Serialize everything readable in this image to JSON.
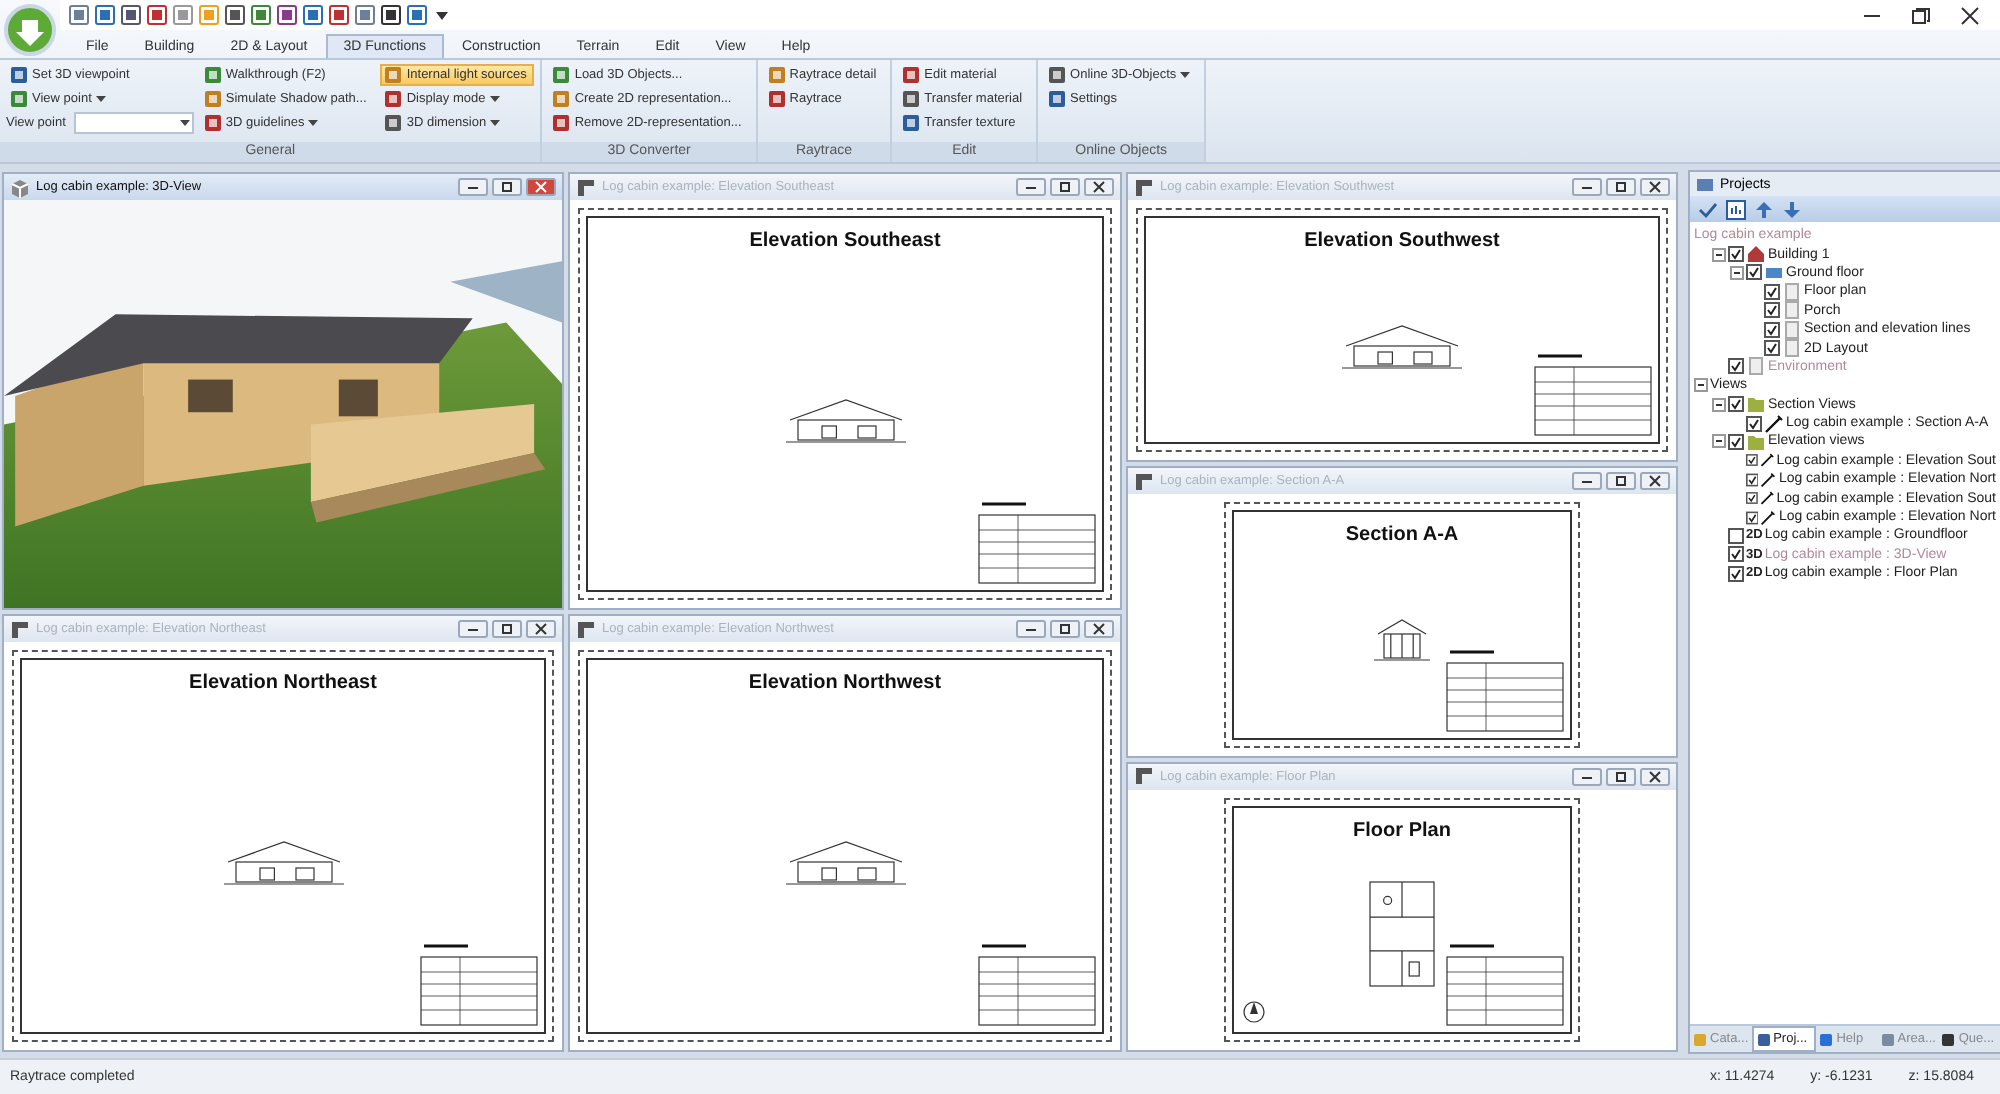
{
  "tabs": [
    {
      "label": "File",
      "selected": false
    },
    {
      "label": "Building",
      "selected": false
    },
    {
      "label": "2D & Layout",
      "selected": false
    },
    {
      "label": "3D Functions",
      "selected": true
    },
    {
      "label": "Construction",
      "selected": false
    },
    {
      "label": "Terrain",
      "selected": false
    },
    {
      "label": "Edit",
      "selected": false
    },
    {
      "label": "View",
      "selected": false
    },
    {
      "label": "Help",
      "selected": false
    }
  ],
  "ribbon": [
    {
      "label": "General",
      "columns": [
        [
          {
            "kind": "button",
            "label": "Set 3D viewpoint",
            "dropdown": false,
            "on": false
          },
          {
            "kind": "button",
            "label": "View point",
            "dropdown": true,
            "on": false
          },
          {
            "kind": "combo",
            "label": "View point",
            "dropdown": true,
            "on": false
          }
        ],
        [
          {
            "kind": "button",
            "label": "Walkthrough (F2)",
            "dropdown": false,
            "on": false
          },
          {
            "kind": "button",
            "label": "Simulate Shadow path...",
            "dropdown": false,
            "on": false
          },
          {
            "kind": "button",
            "label": "3D guidelines",
            "dropdown": true,
            "on": false
          }
        ],
        [
          {
            "kind": "button",
            "label": "Internal light sources",
            "dropdown": false,
            "on": true
          },
          {
            "kind": "button",
            "label": "Display mode",
            "dropdown": true,
            "on": false
          },
          {
            "kind": "button",
            "label": "3D dimension",
            "dropdown": true,
            "on": false
          }
        ]
      ]
    },
    {
      "label": "3D Converter",
      "columns": [
        [
          {
            "kind": "button",
            "label": "Load 3D Objects...",
            "dropdown": false,
            "on": false
          },
          {
            "kind": "button",
            "label": "Create 2D representation...",
            "dropdown": false,
            "on": false
          },
          {
            "kind": "button",
            "label": "Remove 2D-representation...",
            "dropdown": false,
            "on": false
          }
        ]
      ]
    },
    {
      "label": "Raytrace",
      "columns": [
        [
          {
            "kind": "button",
            "label": "Raytrace detail",
            "dropdown": false,
            "on": false
          },
          {
            "kind": "button",
            "label": "Raytrace",
            "dropdown": false,
            "on": false
          }
        ]
      ]
    },
    {
      "label": "Edit",
      "columns": [
        [
          {
            "kind": "button",
            "label": "Edit material",
            "dropdown": false,
            "on": false
          },
          {
            "kind": "button",
            "label": "Transfer material",
            "dropdown": false,
            "on": false
          },
          {
            "kind": "button",
            "label": "Transfer texture",
            "dropdown": false,
            "on": false
          }
        ]
      ]
    },
    {
      "label": "Online Objects",
      "columns": [
        [
          {
            "kind": "button",
            "label": "Online 3D-Objects",
            "dropdown": true,
            "on": false
          },
          {
            "kind": "button",
            "label": "Settings",
            "dropdown": false,
            "on": false
          }
        ]
      ]
    }
  ],
  "columns": [
    {
      "windows": [
        {
          "kind": "render",
          "title": "Log cabin example: 3D-View",
          "active": true
        },
        {
          "kind": "elevation",
          "title": "Log cabin example: Elevation Northeast",
          "heading": "Elevation Northeast",
          "active": false
        }
      ]
    },
    {
      "windows": [
        {
          "kind": "elevation",
          "title": "Log cabin example: Elevation Southeast",
          "heading": "Elevation Southeast",
          "active": false
        },
        {
          "kind": "elevation",
          "title": "Log cabin example: Elevation Northwest",
          "heading": "Elevation Northwest",
          "active": false
        }
      ]
    },
    {
      "windows": [
        {
          "kind": "elevation",
          "title": "Log cabin example: Elevation Southwest",
          "heading": "Elevation Southwest",
          "active": false
        },
        {
          "kind": "section",
          "title": "Log cabin example: Section A-A",
          "heading": "Section A-A",
          "active": false
        },
        {
          "kind": "plan",
          "title": "Log cabin example: Floor Plan",
          "heading": "Floor Plan",
          "active": false
        }
      ]
    }
  ],
  "projects": {
    "title": "Projects",
    "project_name": "Log cabin example",
    "items": [
      {
        "kind": "building",
        "label": "Building 1",
        "checked": true,
        "dimmed": false,
        "expanded": true,
        "children": [
          {
            "kind": "floor",
            "label": "Ground floor",
            "checked": true,
            "dimmed": false,
            "expanded": true,
            "children": [
              {
                "kind": "page",
                "label": "Floor plan",
                "checked": true,
                "dimmed": false
              },
              {
                "kind": "page",
                "label": "Porch",
                "checked": true,
                "dimmed": false
              },
              {
                "kind": "page",
                "label": "Section and elevation lines",
                "checked": true,
                "dimmed": false
              },
              {
                "kind": "page",
                "label": "2D Layout",
                "checked": true,
                "dimmed": false
              }
            ]
          }
        ]
      },
      {
        "kind": "page",
        "label": "Environment",
        "checked": true,
        "dimmed": true
      }
    ],
    "views": {
      "label": "Views",
      "expanded": true,
      "items": [
        {
          "kind": "folder",
          "label": "Section Views",
          "checked": true,
          "dimmed": false,
          "expanded": true,
          "children": [
            {
              "kind": "view",
              "label": "Log cabin example : Section A-A",
              "checked": true,
              "dimmed": false
            }
          ]
        },
        {
          "kind": "folder",
          "label": "Elevation views",
          "checked": true,
          "dimmed": false,
          "expanded": true,
          "children": [
            {
              "kind": "view",
              "label": "Log cabin example : Elevation Sout",
              "checked": true,
              "dimmed": false
            },
            {
              "kind": "view",
              "label": "Log cabin example : Elevation Nort",
              "checked": true,
              "dimmed": false
            },
            {
              "kind": "view",
              "label": "Log cabin example : Elevation Sout",
              "checked": true,
              "dimmed": false
            },
            {
              "kind": "view",
              "label": "Log cabin example : Elevation Nort",
              "checked": true,
              "dimmed": false
            }
          ]
        },
        {
          "kind": "badge",
          "badge": "2D",
          "label": "Log cabin example : Groundfloor",
          "checked": false,
          "dimmed": false
        },
        {
          "kind": "badge",
          "badge": "3D",
          "label": "Log cabin example : 3D-View",
          "checked": true,
          "dimmed": true
        },
        {
          "kind": "badge",
          "badge": "2D",
          "label": "Log cabin example : Floor Plan",
          "checked": true,
          "dimmed": false
        }
      ]
    },
    "tabs": [
      {
        "label": "Cata...",
        "selected": false
      },
      {
        "label": "Proj...",
        "selected": true
      },
      {
        "label": "Help",
        "selected": false
      },
      {
        "label": "Area...",
        "selected": false
      },
      {
        "label": "Que...",
        "selected": false
      }
    ]
  },
  "status_bar": {
    "message": "Raytrace completed",
    "coordinates": [
      "x: 11.4274",
      "y: -6.1231",
      "z: 15.8084"
    ]
  }
}
